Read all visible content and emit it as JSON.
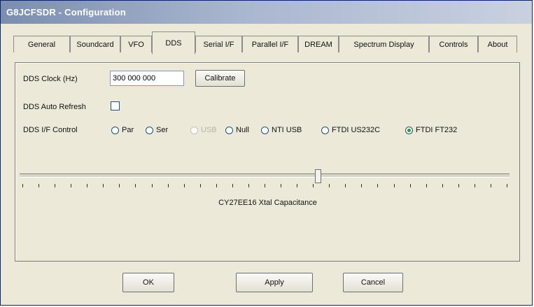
{
  "window": {
    "title": "G8JCFSDR - Configuration"
  },
  "tabs": [
    {
      "label": "General"
    },
    {
      "label": "Soundcard"
    },
    {
      "label": "VFO"
    },
    {
      "label": "DDS"
    },
    {
      "label": "Serial I/F"
    },
    {
      "label": "Parallel I/F"
    },
    {
      "label": "DREAM"
    },
    {
      "label": "Spectrum Display"
    },
    {
      "label": "Controls"
    },
    {
      "label": "About"
    }
  ],
  "active_tab": "DDS",
  "dds": {
    "clock_label": "DDS Clock (Hz)",
    "clock_value": "300 000 000",
    "calibrate_label": "Calibrate",
    "auto_refresh_label": "DDS Auto Refresh",
    "auto_refresh_checked": false,
    "if_control_label": "DDS I/F Control",
    "if_options": [
      {
        "label": "Par",
        "selected": false,
        "disabled": false
      },
      {
        "label": "Ser",
        "selected": false,
        "disabled": false
      },
      {
        "label": "USB",
        "selected": false,
        "disabled": true
      },
      {
        "label": "Null",
        "selected": false,
        "disabled": false
      },
      {
        "label": "NTI USB",
        "selected": false,
        "disabled": false
      },
      {
        "label": "FTDI US232C",
        "selected": false,
        "disabled": false
      },
      {
        "label": "FTDI FT232",
        "selected": true,
        "disabled": false
      }
    ],
    "xtal_slider": {
      "label": "CY27EE16 Xtal Capacitance",
      "position_fraction": 0.61
    }
  },
  "buttons": {
    "ok": "OK",
    "apply": "Apply",
    "cancel": "Cancel"
  },
  "colors": {
    "title_gradient_start": "#7b8eaf",
    "dialog_bg": "#ece9d8",
    "selected_radio": "#21a121"
  }
}
